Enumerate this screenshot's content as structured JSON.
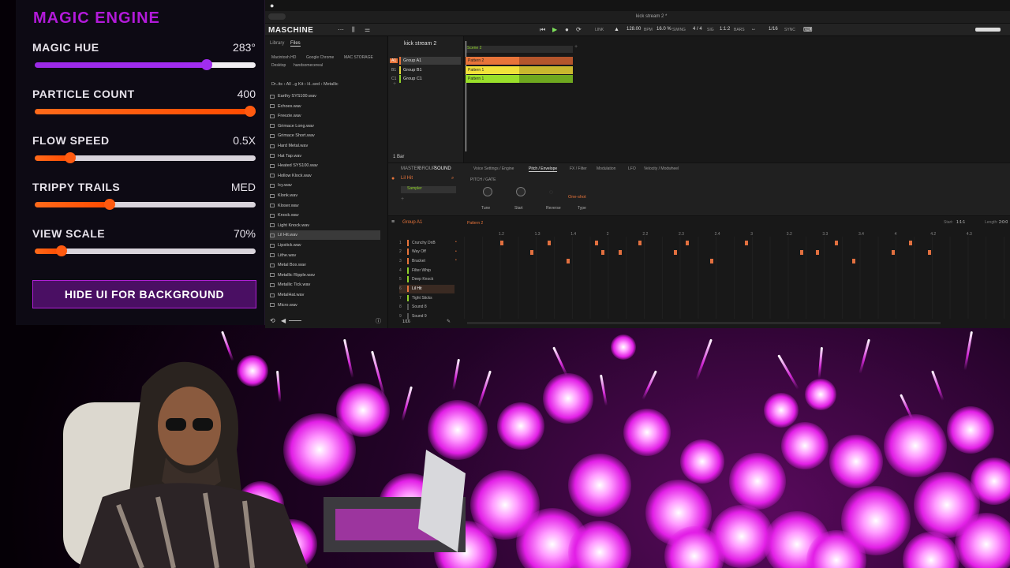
{
  "magic": {
    "title": "MAGIC ENGINE",
    "sliders": [
      {
        "label": "MAGIC HUE",
        "value": "283°",
        "level": 0.78,
        "style": "rainbow"
      },
      {
        "label": "PARTICLE COUNT",
        "value": "400",
        "level": 1.0,
        "style": "orange"
      },
      {
        "label": "FLOW SPEED",
        "value": "0.5X",
        "level": 0.16,
        "style": "orange"
      },
      {
        "label": "TRIPPY TRAILS",
        "value": "MED",
        "level": 0.34,
        "style": "orange"
      },
      {
        "label": "VIEW SCALE",
        "value": "70%",
        "level": 0.12,
        "style": "orange"
      }
    ],
    "hide_button": "HIDE UI FOR BACKGROUND",
    "accent": "#b21ad9"
  },
  "maschine": {
    "app_name": "MASCHINE",
    "window_title": "kick stream 2 *",
    "browser": {
      "tabs": [
        "Library",
        "Files"
      ],
      "locations": [
        "Macintosh HD",
        "Google Chrome",
        "MAC STORAGE",
        "Desktop",
        "handsomecereal"
      ],
      "path": "Dr..its  ›  All ..g Kit  ›  H..sed  ›  Metallic",
      "files": [
        "Earthy SYS100.wav",
        "Echoes.wav",
        "Freezie.wav",
        "Grimace Long.wav",
        "Grimace Short.wav",
        "Hard Metal.wav",
        "Hat Tap.wav",
        "Heated SYS100.wav",
        "Hollow Klock.wav",
        "Icy.wav",
        "Klonk.wav",
        "Kloser.wav",
        "Knock.wav",
        "Light Knock.wav",
        "Lil Hit.wav",
        "Lipstick.wav",
        "Lithe.wav",
        "Metal Box.wav",
        "Metallic Ripple.wav",
        "Metallic Tick.wav",
        "MetalHat.wav",
        "Micro.wav"
      ],
      "selected": "Lil Hit.wav"
    },
    "transport": {
      "bpm": "128.00",
      "bpm_unit": "BPM",
      "swing": "16.0 %",
      "swing_label": "SWING",
      "signature": "4 / 4",
      "sig_label": "SIG",
      "position": "1:1:2",
      "position_label": "BARS",
      "grid": "1/16",
      "sync_label": "SYNC",
      "link_label": "LINK"
    },
    "arranger": {
      "project": "kick stream 2",
      "scene": "Scene 2",
      "groups": [
        {
          "slot": "A1",
          "name": "Group A1",
          "color": "#e8743a"
        },
        {
          "slot": "B1",
          "name": "Group B1",
          "color": "#e8d93a"
        },
        {
          "slot": "C1",
          "name": "Group C1",
          "color": "#8fd12a"
        }
      ],
      "patterns": [
        "Pattern 2",
        "Pattern 1",
        "Pattern 1"
      ],
      "length_label": "1 Bar"
    },
    "sound": {
      "tabs": [
        "MASTER",
        "GROUP",
        "SOUND"
      ],
      "param_tabs": [
        "Voice Settings / Engine",
        "Pitch / Envelope",
        "FX / Filter",
        "Modulation",
        "LFO",
        "Velocity / Modwheel"
      ],
      "active_tab": "Pitch / Envelope",
      "sound_name": "Lil Hit",
      "plugin": "Sampler",
      "section": "PITCH / GATE",
      "knobs": [
        "Tune",
        "Start",
        "Reverse",
        "Type"
      ],
      "type_value": "One-shot"
    },
    "pattern_editor": {
      "group": "Group A1",
      "pattern": "Pattern 2",
      "start_label": "Start:",
      "start_value": "1:1:1",
      "length_label": "Length:",
      "length_value": "2:0:0",
      "grid": "1/16",
      "rulers": [
        "1.2",
        "1.3",
        "1.4",
        "2",
        "2.2",
        "2.3",
        "2.4",
        "3",
        "3.2",
        "3.3",
        "3.4",
        "4",
        "4.2",
        "4.3"
      ],
      "rows": [
        {
          "num": "1",
          "name": "Crunchy DnB",
          "color": "#e8743a"
        },
        {
          "num": "2",
          "name": "Way Off",
          "color": "#e8743a"
        },
        {
          "num": "3",
          "name": "Bracket",
          "color": "#e8743a"
        },
        {
          "num": "4",
          "name": "Filter Whip",
          "color": "#8fd12a"
        },
        {
          "num": "5",
          "name": "Deep Knock",
          "color": "#8fd12a"
        },
        {
          "num": "6",
          "name": "Lil Hit",
          "color": "#e8743a"
        },
        {
          "num": "7",
          "name": "Tight Sticks",
          "color": "#8fd12a"
        },
        {
          "num": "8",
          "name": "Sound 8",
          "color": "#555555"
        },
        {
          "num": "9",
          "name": "Sound 9",
          "color": "#555555"
        }
      ]
    }
  }
}
